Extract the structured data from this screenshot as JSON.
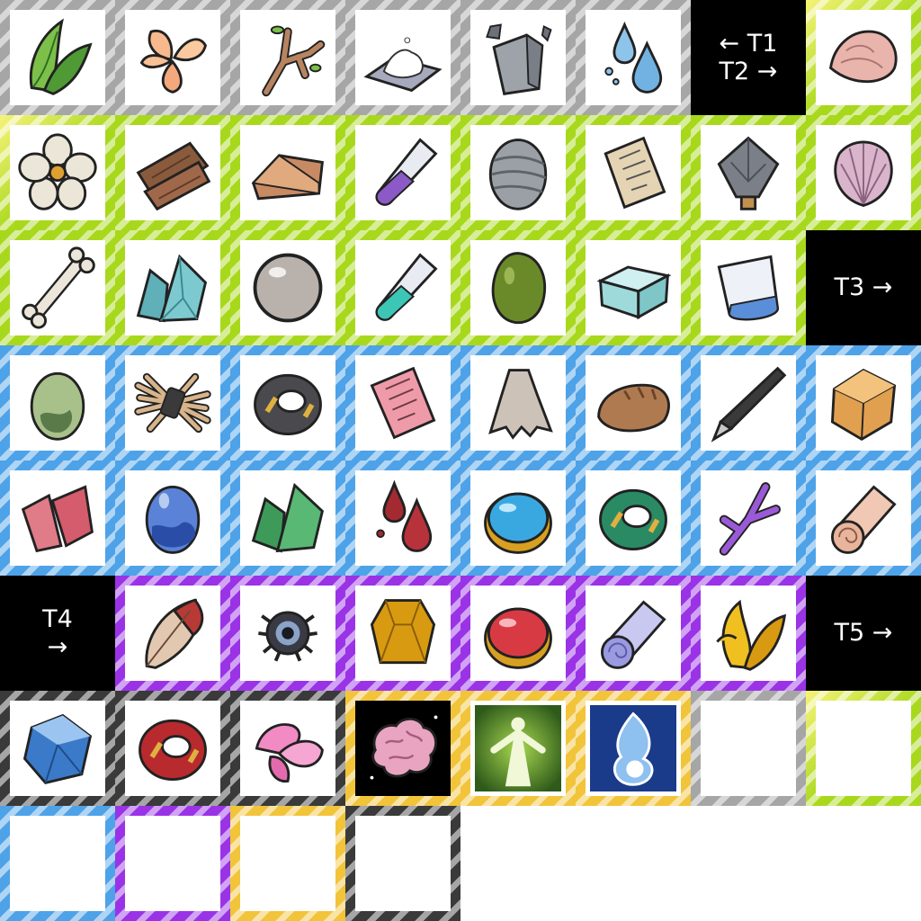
{
  "labels": {
    "t1_t2": "← T1\nT2 →",
    "t3": "T3 →",
    "t4": "T4\n→",
    "t5": "T5 →"
  },
  "tiers": {
    "grey": "#a6a6a6",
    "green": "#a8d81c",
    "blue": "#4ea2e8",
    "purple": "#9a33e6",
    "dark": "#3a3a3a",
    "gold": "#f1c43a"
  },
  "icons": [
    "green-leaf-icon",
    "peach-petals-icon",
    "twig-icon",
    "salt-pile-icon",
    "stone-chunk-icon",
    "water-drops-icon",
    "tier-label-t1-t2",
    "pink-shell-icon",
    "white-flower-icon",
    "wood-planks-icon",
    "copper-ingot-icon",
    "purple-potion-vial-icon",
    "cloth-bundle-icon",
    "parchment-scroll-icon",
    "flint-arrowhead-icon",
    "clam-shell-icon",
    "bone-icon",
    "teal-crystal-icon",
    "pearl-icon",
    "teal-potion-vial-icon",
    "green-gem-icon",
    "ice-block-icon",
    "glass-cup-icon",
    "tier-label-t3",
    "green-egg-icon",
    "straw-bundle-icon",
    "iron-ring-icon",
    "pink-letter-icon",
    "cloth-tatters-icon",
    "bread-loaf-icon",
    "quill-pen-icon",
    "amber-cube-icon",
    "red-crystal-shards-icon",
    "blue-egg-icon",
    "emerald-crystal-icon",
    "blood-drops-icon",
    "sapphire-gem-icon",
    "jade-ring-icon",
    "purple-branch-icon",
    "leather-roll-icon",
    "tier-label-t4",
    "red-feather-icon",
    "spider-eye-icon",
    "topaz-gem-icon",
    "ruby-gem-icon",
    "lavender-fabric-roll-icon",
    "golden-leaf-icon",
    "tier-label-t5",
    "blue-diamond-icon",
    "crimson-ring-icon",
    "pink-petals-icon",
    "brain-skill-icon",
    "spirit-skill-icon",
    "water-flame-skill-icon",
    "empty-slot-icon",
    "empty-slot-icon",
    "empty-slot-icon",
    "empty-slot-icon",
    "empty-slot-icon",
    "empty-slot-icon"
  ]
}
